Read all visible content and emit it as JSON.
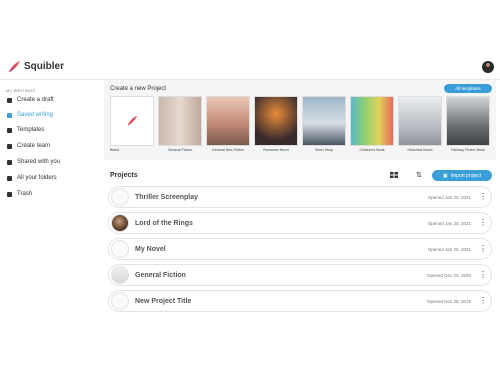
{
  "app": {
    "name": "Squibler"
  },
  "colors": {
    "accent": "#3a9fd8"
  },
  "sidebar": {
    "section_label": "MY WRITINGS",
    "items": [
      {
        "label": "Create a draft",
        "icon": "doc-icon"
      },
      {
        "label": "Saved writing",
        "icon": "doc-icon"
      },
      {
        "label": "Templates",
        "icon": "templates-icon"
      },
      {
        "label": "Create team",
        "icon": "team-icon"
      },
      {
        "label": "Shared with you",
        "icon": "share-icon"
      },
      {
        "label": "All your folders",
        "icon": "folder-icon"
      },
      {
        "label": "Trash",
        "icon": "trash-icon"
      }
    ]
  },
  "templates": {
    "title": "Create a new Project",
    "all_button": "All templates",
    "items": [
      {
        "caption": "Blank"
      },
      {
        "caption": "General Fiction"
      },
      {
        "caption": "General Non-Fiction"
      },
      {
        "caption": "Romance Novel"
      },
      {
        "caption": "Short Story"
      },
      {
        "caption": "Children's Book"
      },
      {
        "caption": "Historical Novel"
      },
      {
        "caption": "Fantasy Fiction Book"
      }
    ]
  },
  "projects": {
    "title": "Projects",
    "import_button": "Import project",
    "rows": [
      {
        "title": "Thriller Screenplay",
        "opened": "Opened Jan 20, 2021"
      },
      {
        "title": "Lord of the Rings",
        "opened": "Opened Jan 20, 2021"
      },
      {
        "title": "My Novel",
        "opened": "Opened Jan 20, 2021"
      },
      {
        "title": "General Fiction",
        "opened": "Opened Dec 23, 2020"
      },
      {
        "title": "New Project Title",
        "opened": "Opened Nov 28, 2019"
      }
    ]
  }
}
